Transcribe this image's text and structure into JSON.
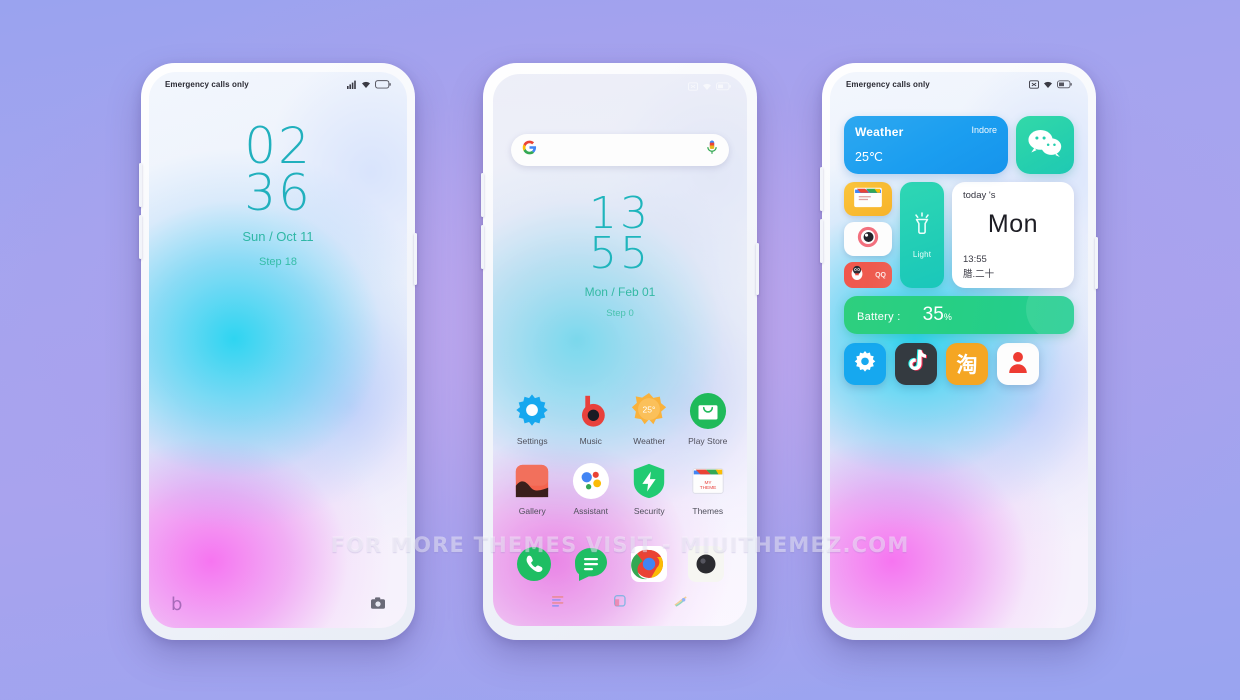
{
  "watermark": "FOR MORE THEMES VISIT - MIUITHEMEZ.COM",
  "colors": {
    "background_top": "#9aa3ef",
    "background_mid": "#c4a8ee",
    "clock_accent": "#21b0bd",
    "date_accent": "#2fb7a6",
    "weather_widget": "#1b9ef0",
    "wechat_widget": "#25cfae",
    "battery_widget": "#26cf85",
    "light_widget": "#21cdb6",
    "qq_widget": "#ee5b4f",
    "themes_widget": "#f7b32a"
  },
  "lockscreen": {
    "statusbar": {
      "carrier": "Emergency calls only",
      "icons": [
        "signal-icon",
        "wifi-icon",
        "battery-icon"
      ]
    },
    "clock": {
      "hours": "02",
      "minutes": "36"
    },
    "date": "Sun / Oct 11",
    "step": "Step 18",
    "shortcuts": {
      "left": "music-shortcut-icon",
      "left_glyph": "b",
      "right": "camera-shortcut-icon"
    }
  },
  "homescreen": {
    "statusbar": {
      "carrier": "",
      "icons": [
        "no-sim-icon",
        "wifi-icon",
        "battery-icon"
      ]
    },
    "search": {
      "placeholder": "",
      "value": "",
      "left_icon": "google-g-icon",
      "right_icon": "microphone-icon"
    },
    "clock": {
      "hours": "13",
      "minutes": "55"
    },
    "date": "Mon / Feb 01",
    "step": "Step 0",
    "apps": [
      {
        "label": "Settings",
        "icon": "settings-gear-icon"
      },
      {
        "label": "Music",
        "icon": "music-b-icon"
      },
      {
        "label": "Weather",
        "icon": "weather-sun-icon",
        "badge": "25°"
      },
      {
        "label": "Play Store",
        "icon": "play-store-bag-icon"
      },
      {
        "label": "Gallery",
        "icon": "gallery-landscape-icon"
      },
      {
        "label": "Assistant",
        "icon": "google-assistant-icon"
      },
      {
        "label": "Security",
        "icon": "security-shield-icon"
      },
      {
        "label": "Themes",
        "icon": "themes-icon",
        "badge": "MY THEME"
      }
    ],
    "dock": [
      {
        "label": "Phone",
        "icon": "phone-handset-icon"
      },
      {
        "label": "Messages",
        "icon": "messages-bubble-icon"
      },
      {
        "label": "Chrome",
        "icon": "chrome-icon"
      },
      {
        "label": "Camera",
        "icon": "camera-lens-icon"
      }
    ],
    "page_indicators": [
      "list-page-icon",
      "square-page-icon",
      "brush-page-icon"
    ]
  },
  "widgetscreen": {
    "statusbar": {
      "carrier": "Emergency calls only",
      "icons": [
        "no-sim-icon",
        "wifi-icon",
        "battery-icon"
      ]
    },
    "weather": {
      "title": "Weather",
      "city": "Indore",
      "temp": "25℃"
    },
    "wechat": {
      "icon": "wechat-icon"
    },
    "themes_tile": {
      "icon": "themes-icon"
    },
    "eye_tile": {
      "icon": "camera-eye-icon"
    },
    "qq_tile": {
      "icon": "qq-penguin-icon",
      "mark": "QQ"
    },
    "light": {
      "label": "Light",
      "icon": "flashlight-icon"
    },
    "today": {
      "title": "today 's",
      "day": "Mon",
      "time": "13:55",
      "lunar": "腊.二十"
    },
    "battery": {
      "label": "Battery :",
      "value": "35",
      "unit": "%"
    },
    "bottom_icons": [
      {
        "name": "Settings",
        "icon": "settings-gear-icon"
      },
      {
        "name": "TikTok",
        "icon": "tiktok-note-icon"
      },
      {
        "name": "Taobao",
        "icon": "taobao-icon",
        "glyph": "淘"
      },
      {
        "name": "Contacts",
        "icon": "contacts-person-icon"
      }
    ]
  }
}
